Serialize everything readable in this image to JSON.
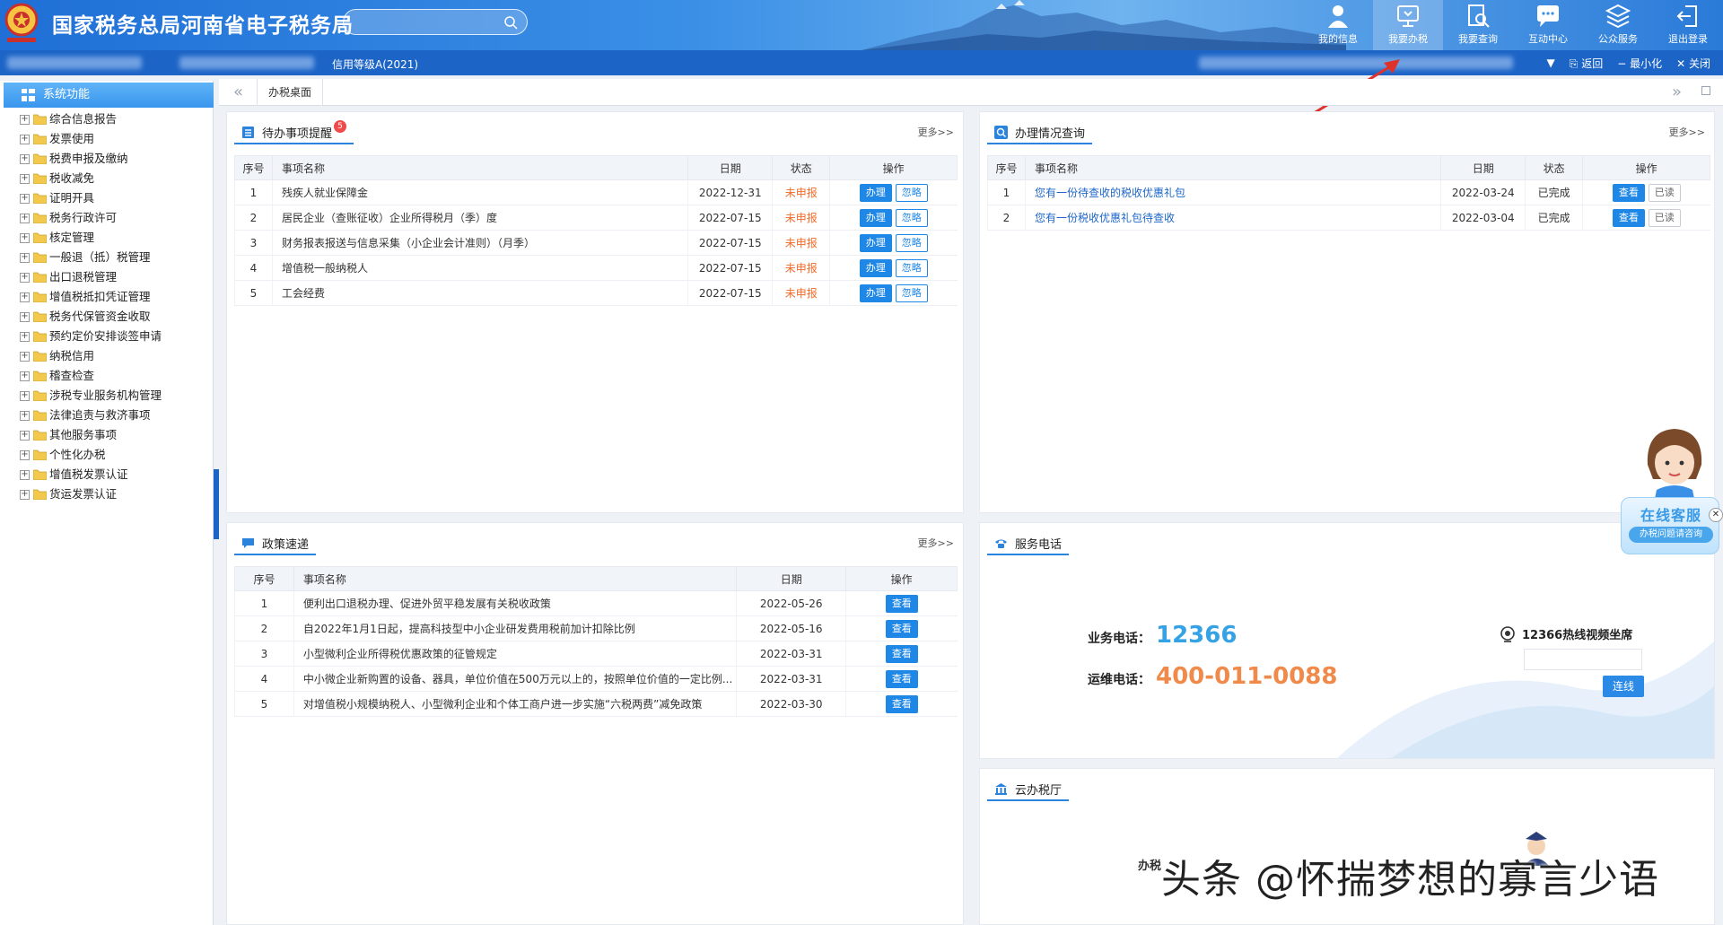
{
  "header": {
    "title": "国家税务总局河南省电子税务局",
    "search_placeholder": "",
    "nav": [
      {
        "label": "我的信息",
        "icon": "user-icon"
      },
      {
        "label": "我要办税",
        "icon": "monitor-icon"
      },
      {
        "label": "我要查询",
        "icon": "magnifier-doc-icon"
      },
      {
        "label": "互动中心",
        "icon": "chat-icon"
      },
      {
        "label": "公众服务",
        "icon": "layers-icon"
      },
      {
        "label": "退出登录",
        "icon": "logout-icon"
      }
    ]
  },
  "subbar": {
    "credit": "信用等级A(2021)",
    "back": "返回",
    "minimize": "最小化",
    "close": "关闭"
  },
  "sidebar": {
    "title": "系统功能",
    "items": [
      "综合信息报告",
      "发票使用",
      "税费申报及缴纳",
      "税收减免",
      "证明开具",
      "税务行政许可",
      "核定管理",
      "一般退（抵）税管理",
      "出口退税管理",
      "增值税抵扣凭证管理",
      "税务代保管资金收取",
      "预约定价安排谈签申请",
      "纳税信用",
      "稽查检查",
      "涉税专业服务机构管理",
      "法律追责与救济事项",
      "其他服务事项",
      "个性化办税",
      "增值税发票认证",
      "货运发票认证"
    ]
  },
  "tabbar": {
    "home": "办税桌面"
  },
  "todo": {
    "title": "待办事项提醒",
    "badge": "5",
    "more": "更多>>",
    "headers": [
      "序号",
      "事项名称",
      "日期",
      "状态",
      "操作"
    ],
    "rows": [
      {
        "no": "1",
        "name": "残疾人就业保障金",
        "date": "2022-12-31",
        "status": "未申报"
      },
      {
        "no": "2",
        "name": "居民企业（查账征收）企业所得税月（季）度",
        "date": "2022-07-15",
        "status": "未申报"
      },
      {
        "no": "3",
        "name": "财务报表报送与信息采集（小企业会计准则）（月季）",
        "date": "2022-07-15",
        "status": "未申报"
      },
      {
        "no": "4",
        "name": "增值税一般纳税人",
        "date": "2022-07-15",
        "status": "未申报"
      },
      {
        "no": "5",
        "name": "工会经费",
        "date": "2022-07-15",
        "status": "未申报"
      }
    ],
    "btn_do": "办理",
    "btn_ignore": "忽略"
  },
  "query": {
    "title": "办理情况查询",
    "more": "更多>>",
    "headers": [
      "序号",
      "事项名称",
      "日期",
      "状态",
      "操作"
    ],
    "rows": [
      {
        "no": "1",
        "name": "您有一份待查收的税收优惠礼包",
        "date": "2022-03-24",
        "status": "已完成"
      },
      {
        "no": "2",
        "name": "您有一份税收优惠礼包待查收",
        "date": "2022-03-04",
        "status": "已完成"
      }
    ],
    "btn_view": "查看",
    "btn_read": "已读"
  },
  "policy": {
    "title": "政策速递",
    "more": "更多>>",
    "headers": [
      "序号",
      "事项名称",
      "日期",
      "操作"
    ],
    "rows": [
      {
        "no": "1",
        "name": "便利出口退税办理、促进外贸平稳发展有关税收政策",
        "date": "2022-05-26"
      },
      {
        "no": "2",
        "name": "自2022年1月1日起，提高科技型中小企业研发费用税前加计扣除比例",
        "date": "2022-05-16"
      },
      {
        "no": "3",
        "name": "小型微利企业所得税优惠政策的征管规定",
        "date": "2022-03-31"
      },
      {
        "no": "4",
        "name": "中小微企业新购置的设备、器具，单位价值在500万元以上的，按照单位价值的一定比例...",
        "date": "2022-03-31"
      },
      {
        "no": "5",
        "name": "对增值税小规模纳税人、小型微利企业和个体工商户进一步实施“六税两费”减免政策",
        "date": "2022-03-30"
      }
    ],
    "btn_view": "查看"
  },
  "service": {
    "title": "服务电话",
    "biz_label": "业务电话：",
    "biz_num": "12366",
    "ops_label": "运维电话：",
    "ops_num": "400-011-0088",
    "video_label": "12366热线视频坐席",
    "connect": "连线"
  },
  "cloud": {
    "title": "云办税厅",
    "text": "办税"
  },
  "cs_widget": {
    "title": "在线客服",
    "sub": "办税问题请咨询"
  },
  "watermark": "头条 @怀揣梦想的寡言少语",
  "colors": {
    "primary": "#1c64c6",
    "accent": "#1f87e6",
    "warn": "#ef6c2a"
  }
}
